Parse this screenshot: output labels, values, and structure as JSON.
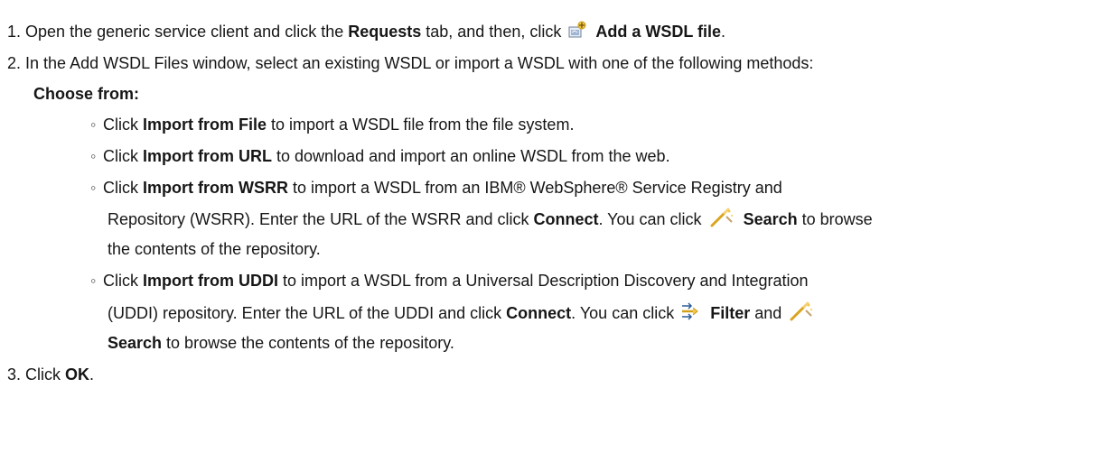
{
  "steps": [
    {
      "number": "1.",
      "parts": {
        "a": "Open the generic service client and click the ",
        "b_requests": "Requests",
        "c": " tab, and then, click ",
        "d_add": "Add a WSDL file",
        "e": "."
      }
    },
    {
      "number": "2.",
      "text": "In the Add WSDL Files window, select an existing WSDL or import a WSDL with one of the following methods:",
      "choose_from": "Choose from:",
      "options": [
        {
          "pre": "Click ",
          "bold": "Import from File",
          "post": " to import a WSDL file from the file system."
        },
        {
          "pre": "Click ",
          "bold": "Import from URL",
          "post": " to download and import an online WSDL from the web."
        },
        {
          "pre": "Click ",
          "bold": "Import from WSRR",
          "post": " to import a WSDL from an IBM® WebSphere® Service Registry and",
          "line2_pre": "Repository (WSRR). Enter the URL of the WSRR and click ",
          "line2_connect": "Connect",
          "line2_mid": ". You can click ",
          "line2_search": "Search",
          "line2_post": " to browse",
          "line3": "the contents of the repository."
        },
        {
          "pre": "Click ",
          "bold": "Import from UDDI",
          "post": " to import a WSDL from a Universal Description Discovery and Integration",
          "line2_pre": "(UDDI) repository. Enter the URL of the UDDI and click ",
          "line2_connect": "Connect",
          "line2_mid": ". You can click ",
          "line2_filter": "Filter",
          "line2_and": " and ",
          "line3_search": "Search",
          "line3_post": " to browse the contents of the repository."
        }
      ]
    },
    {
      "number": "3.",
      "pre": "Click ",
      "bold": "OK",
      "post": "."
    }
  ],
  "bullet_glyph": "◦",
  "icons": {
    "add_wsdl": "add-wsdl-icon",
    "search": "search-wand-icon",
    "filter": "filter-arrows-icon"
  }
}
